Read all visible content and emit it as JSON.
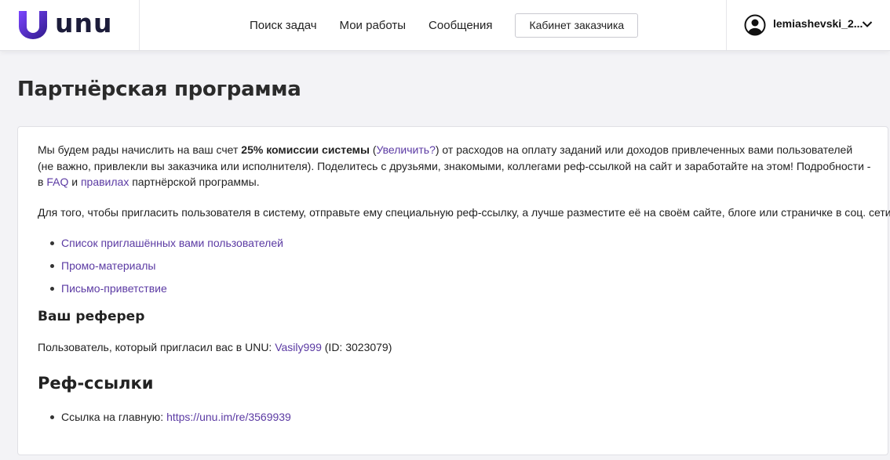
{
  "brand": {
    "name": "unu",
    "logo_gradient_top": "#6a3df0",
    "logo_gradient_bottom": "#3b1fa0"
  },
  "nav": {
    "items": [
      {
        "label": "Поиск задач"
      },
      {
        "label": "Мои работы"
      },
      {
        "label": "Сообщения"
      }
    ],
    "cabinet_button": "Кабинет заказчика"
  },
  "user": {
    "name": "lemiashevski_2..."
  },
  "page": {
    "title": "Партнёрская программа"
  },
  "intro": {
    "t1": "Мы будем рады начислить на ваш счет ",
    "bold": "25% комиссии системы",
    "t2": " (",
    "increase_link": "Увеличить?",
    "t3": ") от расходов на оплату заданий или доходов привлеченных вами пользователей (не важно, привлекли вы заказчика или исполнителя). Поделитесь с друзьями, знакомыми, коллегами реф-ссылкой на сайт и заработайте на этом! Подробности - в ",
    "faq_link": "FAQ",
    "t4": " и ",
    "rules_link": "правилах",
    "t5": " партнёрской программы."
  },
  "invite_text": "Для того, чтобы пригласить пользователя в систему, отправьте ему специальную реф-ссылку, а лучше разместите её на своём сайте, блоге или страничке в соц. сети",
  "links": [
    {
      "label": "Список приглашённых вами пользователей"
    },
    {
      "label": "Промо-материалы"
    },
    {
      "label": "Письмо-приветствие"
    }
  ],
  "referrer": {
    "heading": "Ваш реферер",
    "prefix": "Пользователь, который пригласил вас в UNU: ",
    "user_link": "Vasily999",
    "suffix": " (ID: 3023079)"
  },
  "ref_links": {
    "heading": "Реф-ссылки",
    "items": [
      {
        "prefix": "Ссылка на главную: ",
        "url": "https://unu.im/re/3569939"
      }
    ]
  },
  "colors": {
    "link": "#5b3aa3",
    "background": "#f3f3f6"
  }
}
